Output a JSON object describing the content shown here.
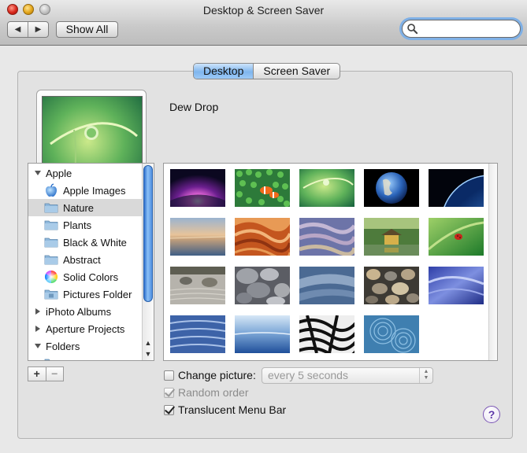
{
  "window": {
    "title": "Desktop & Screen Saver"
  },
  "toolbar": {
    "back_icon": "back-arrow-icon",
    "forward_icon": "forward-arrow-icon",
    "show_all_label": "Show All",
    "search": {
      "value": "",
      "icon": "search-icon"
    }
  },
  "tabs": [
    {
      "label": "Desktop",
      "active": true
    },
    {
      "label": "Screen Saver",
      "active": false
    }
  ],
  "current_picture": {
    "name": "Dew Drop"
  },
  "source_list": [
    {
      "label": "Apple",
      "type": "group",
      "expanded": true
    },
    {
      "label": "Apple Images",
      "type": "item",
      "icon": "apple-logo-icon"
    },
    {
      "label": "Nature",
      "type": "item",
      "icon": "folder-icon",
      "selected": true
    },
    {
      "label": "Plants",
      "type": "item",
      "icon": "folder-icon"
    },
    {
      "label": "Black & White",
      "type": "item",
      "icon": "folder-icon"
    },
    {
      "label": "Abstract",
      "type": "item",
      "icon": "folder-icon"
    },
    {
      "label": "Solid Colors",
      "type": "item",
      "icon": "color-wheel-icon"
    },
    {
      "label": "Pictures Folder",
      "type": "item",
      "icon": "pictures-folder-icon"
    },
    {
      "label": "iPhoto Albums",
      "type": "group",
      "expanded": false
    },
    {
      "label": "Aperture Projects",
      "type": "group",
      "expanded": false
    },
    {
      "label": "Folders",
      "type": "group",
      "expanded": true
    }
  ],
  "list_buttons": {
    "add": "+",
    "remove": "−"
  },
  "thumbnails": [
    {
      "name": "aurora"
    },
    {
      "name": "clownfish"
    },
    {
      "name": "dew-drop"
    },
    {
      "name": "earth"
    },
    {
      "name": "earth-horizon"
    },
    {
      "name": "evening-reflections"
    },
    {
      "name": "sandstone-waves"
    },
    {
      "name": "blue-sand"
    },
    {
      "name": "golden-pavilion"
    },
    {
      "name": "ladybug"
    },
    {
      "name": "zen-garden"
    },
    {
      "name": "pebbles"
    },
    {
      "name": "blue-dunes"
    },
    {
      "name": "river-stones"
    },
    {
      "name": "blue-silk"
    },
    {
      "name": "blue-ripples"
    },
    {
      "name": "horizon-sea"
    },
    {
      "name": "zebra"
    },
    {
      "name": "rain-ripples"
    }
  ],
  "options": {
    "change_picture": {
      "label": "Change picture:",
      "checked": false
    },
    "interval": {
      "value": "every 5 seconds"
    },
    "random_order": {
      "label": "Random order",
      "checked": true,
      "disabled": true
    },
    "translucent_menu_bar": {
      "label": "Translucent Menu Bar",
      "checked": true
    }
  },
  "help": {
    "label": "?"
  }
}
